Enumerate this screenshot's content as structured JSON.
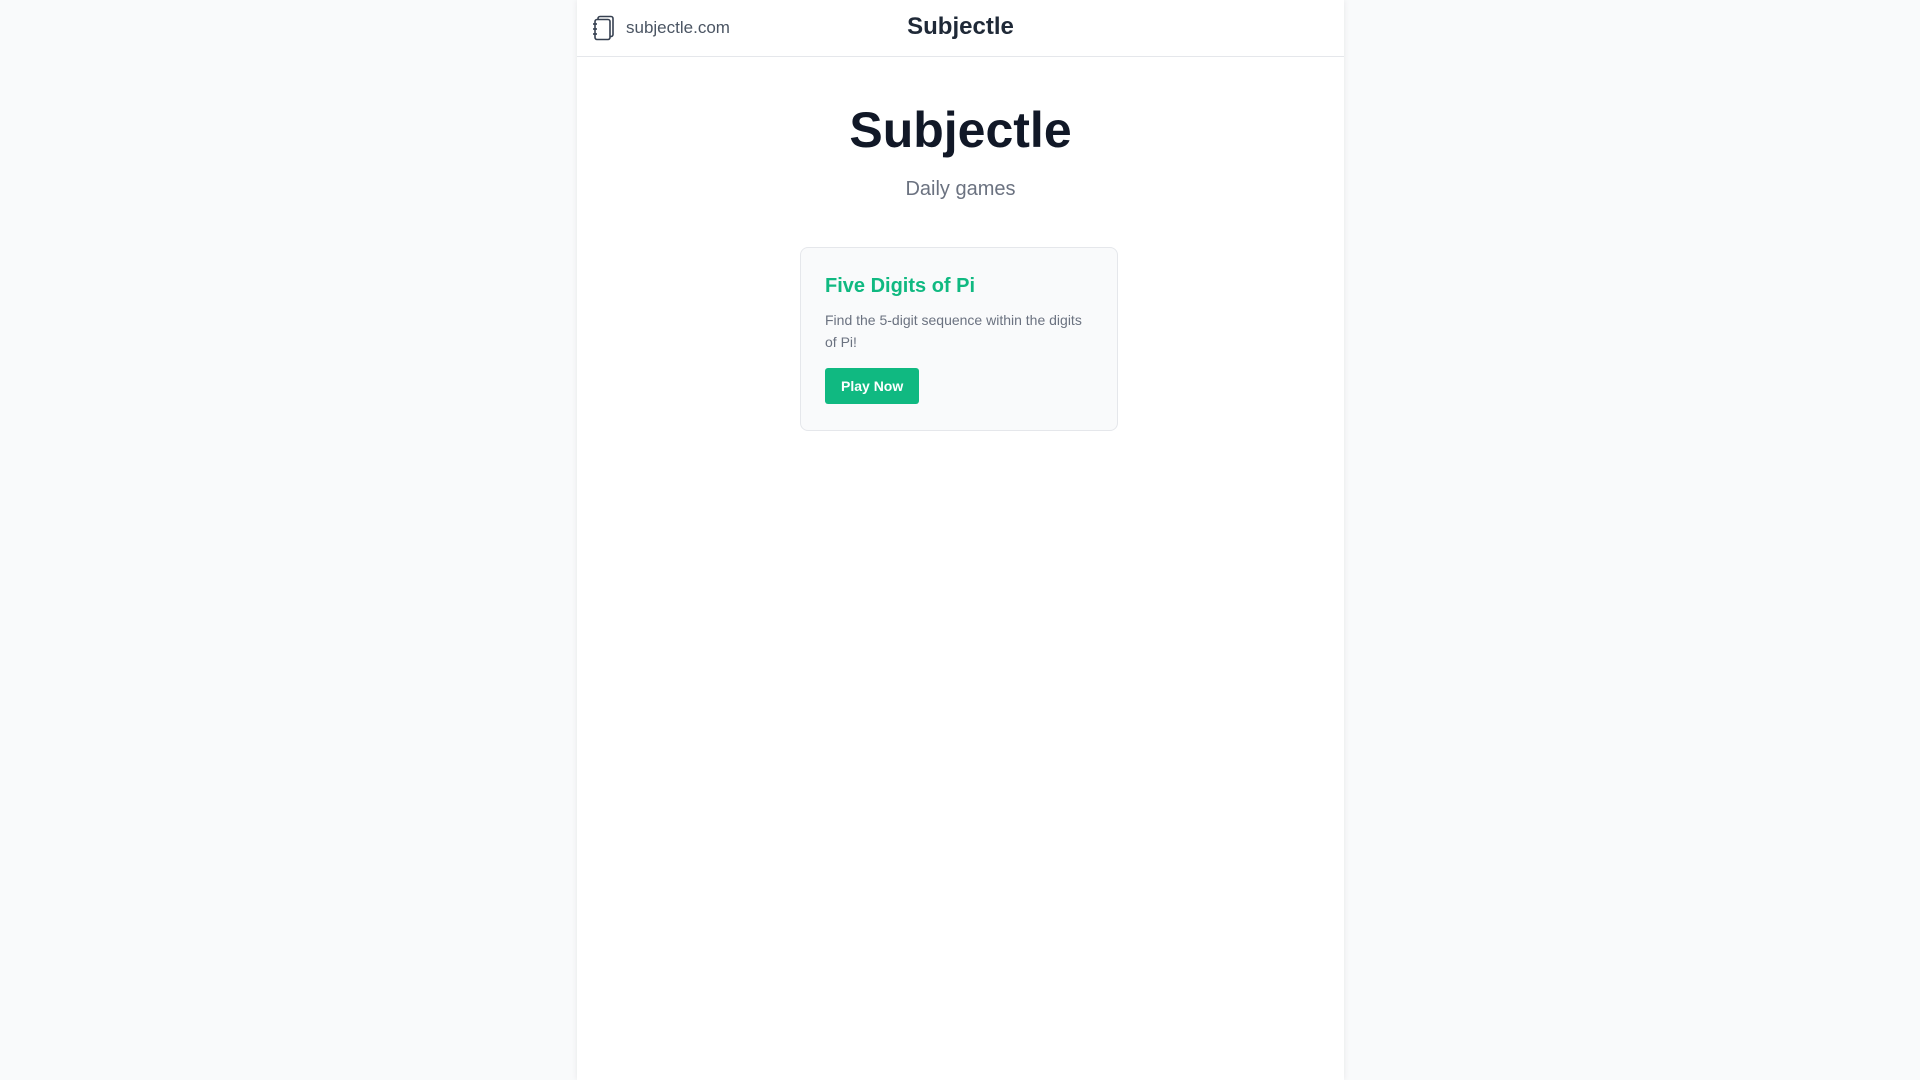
{
  "header": {
    "site_link": "subjectle.com",
    "site_icon": "notebook-icon",
    "title": "Subjectle"
  },
  "hero": {
    "title": "Subjectle",
    "subtitle": "Daily games"
  },
  "games": [
    {
      "title": "Five Digits of Pi",
      "description": "Find the 5-digit sequence within the digits of Pi!",
      "button_label": "Play Now"
    }
  ],
  "colors": {
    "accent": "#10b981",
    "title": "#111827",
    "muted": "#6b7280",
    "background": "#f9fafb"
  }
}
